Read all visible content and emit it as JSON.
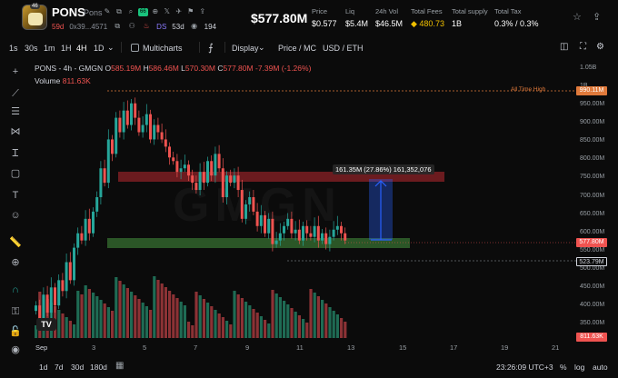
{
  "token": {
    "name": "PONS",
    "sub_name": "Pons",
    "badge": "46",
    "age": "59d",
    "address": "0x39...4571",
    "chip": "66",
    "ds_label": "DS",
    "ds_age": "53d",
    "holders": "194",
    "price": "$577.80M"
  },
  "stats": [
    {
      "label": "Price",
      "value": "$0.577"
    },
    {
      "label": "Liq",
      "value": "$5.4M"
    },
    {
      "label": "24h Vol",
      "value": "$46.5M"
    },
    {
      "label": "Total Fees",
      "value": "480.73"
    },
    {
      "label": "Total supply",
      "value": "1B"
    },
    {
      "label": "Total Tax",
      "value": "0.3% / 0.3%"
    }
  ],
  "timeframes": [
    "1s",
    "30s",
    "1m",
    "1H",
    "4H",
    "1D"
  ],
  "active_timeframe": "4H",
  "toolbar": {
    "multicharts": "Multicharts",
    "display": "Display",
    "price_mc": "Price / MC",
    "usd_eth": "USD / ETH"
  },
  "legend": {
    "title": "PONS - 4h - GMGN",
    "open_label": "O",
    "open": "585.19M",
    "high_label": "H",
    "high": "586.46M",
    "low_label": "L",
    "low": "570.30M",
    "close_label": "C",
    "close": "577.80M",
    "change": "-7.39M (-1.26%)",
    "volume_label": "Volume",
    "volume": "811.63K"
  },
  "watermark": "GMGN",
  "y_axis": [
    "1.05B",
    "1B",
    "950.00M",
    "900.00M",
    "850.00M",
    "800.00M",
    "750.00M",
    "700.00M",
    "650.00M",
    "600.00M",
    "550.00M",
    "500.00M",
    "450.00M",
    "400.00M",
    "350.00M"
  ],
  "price_tags": {
    "ath": "990.11M",
    "ath_label": "All Time High",
    "current": "577.80M",
    "low_line": "523.79M",
    "volume": "811.63K"
  },
  "measure_label": "161.35M (27.86%) 161,352,076",
  "x_axis": [
    "Sep",
    "3",
    "5",
    "7",
    "9",
    "11",
    "13",
    "15",
    "17",
    "19",
    "21"
  ],
  "bottom": {
    "ranges": [
      "1d",
      "7d",
      "30d",
      "180d"
    ],
    "time": "23:26:09 UTC+3",
    "percent": "%",
    "log": "log",
    "auto": "auto"
  },
  "colors": {
    "up": "#26a69a",
    "down": "#ef5350",
    "ath": "#e07a3b",
    "current": "#ef5350",
    "measure": "#2962ff",
    "fees": "#f0c000"
  },
  "chart_data": {
    "type": "candlestick",
    "title": "PONS - 4h - GMGN",
    "xlabel": "",
    "ylabel": "",
    "ylim": [
      340,
      1060
    ],
    "x_ticks": [
      "Sep",
      "3",
      "5",
      "7",
      "9",
      "11",
      "13",
      "15",
      "17",
      "19",
      "21"
    ],
    "candles_close": [
      400,
      360,
      430,
      380,
      450,
      400,
      470,
      440,
      520,
      470,
      560,
      600,
      580,
      640,
      600,
      660,
      700,
      780,
      740,
      860,
      820,
      920,
      880,
      940,
      900,
      960,
      920,
      880,
      900,
      930,
      860,
      900,
      880,
      860,
      840,
      810,
      800,
      770,
      780,
      790,
      760,
      740,
      720,
      770,
      740,
      800,
      760,
      820,
      780,
      700,
      760,
      740,
      760,
      720,
      640,
      680,
      700,
      660,
      620,
      650,
      600,
      640,
      570,
      580,
      600,
      620,
      640,
      600,
      610,
      580,
      620,
      600,
      590,
      620,
      580,
      600,
      570,
      590,
      610,
      620,
      600,
      580
    ],
    "volume_bars": 82,
    "annotations": {
      "all_time_high": 990.11,
      "current": 577.8,
      "low_line": 523.79,
      "measure_from": 577.8,
      "measure_to": 739.15,
      "resistance_zone": [
        740,
        760
      ],
      "support_zone": [
        560,
        585
      ]
    }
  }
}
